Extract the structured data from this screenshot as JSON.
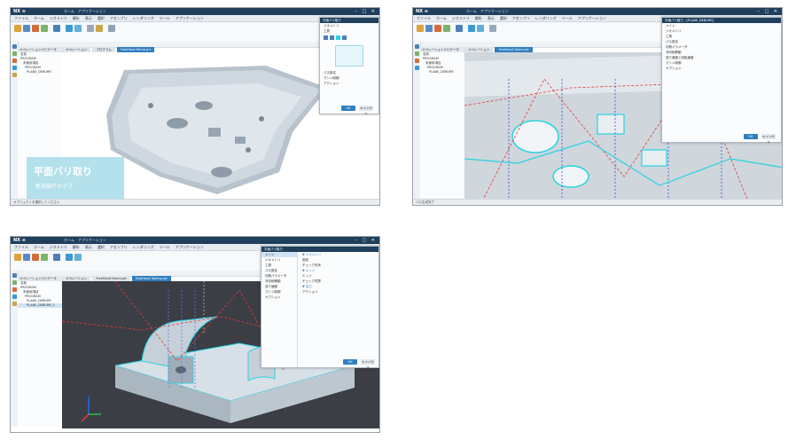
{
  "app": {
    "brand": "NX ≡",
    "window_title": "ホーム　アプリケーション",
    "window_buttons": "–  □  ✕",
    "menu": [
      "ファイル",
      "ホーム",
      "ジオメトリ",
      "解析",
      "表示",
      "選択",
      "アセンブリ",
      "レンダリング",
      "ツール",
      "アプリケーション",
      "環境設定",
      "ツールボックス"
    ],
    "colors": {
      "titlebar": "#1f3f5c",
      "accent": "#2f7fc1",
      "model": "#c9d3dc",
      "cyan_edge": "#27d3e3"
    }
  },
  "panel1": {
    "tabs": [
      "オペレーション",
      "プログラム",
      "FreeHand Demo.prt"
    ],
    "navigator_header": "オペレーションナビゲータ",
    "navigator_items": [
      "名前",
      "PROGRAM",
      "未使用項目",
      "PROGRAM",
      "PLANE_DEBURR"
    ],
    "dialog_title": "平面バリ取り",
    "dialog_rows": [
      "ジオメトリ",
      "工具",
      "パス設定",
      "マシン制御",
      "アクション"
    ],
    "dialog_ok": "OK",
    "dialog_cancel": "キャンセル",
    "caption_main": "平面バリ取り",
    "caption_sub": "新規操作タイプ",
    "status": "オブジェクトを選択してください"
  },
  "panel2": {
    "tabs": [
      "オペレーション",
      "FreeHand Demo.prt"
    ],
    "navigator_header": "オペレーションナビゲータ",
    "navigator_items": [
      "名前",
      "PROGRAM",
      "未使用項目",
      "PROGRAM",
      "PLANE_DEBURR"
    ],
    "dialog_title": "平面バリ取り - [PLANE_DEBURR]",
    "dialog_rows": [
      "メイン",
      "ジオメトリ",
      "工具",
      "パス設定",
      "切削パラメータ",
      "非切削移動",
      "送り速度と回転速度",
      "マシン制御",
      "オプション"
    ],
    "dialog_ok": "OK",
    "dialog_cancel": "キャンセル",
    "status": "パス生成完了"
  },
  "panel3": {
    "tabs": [
      "オペレーション",
      "FreeHand Demo.prt",
      "FreeHand Tooling.prt"
    ],
    "navigator_header": "オペレーションナビゲータ",
    "navigator_items": [
      "名前",
      "PROGRAM",
      "未使用項目",
      "PROGRAM",
      "PLANE_DEBURR",
      "PLANE_DEBURR_1"
    ],
    "dialog_title": "平面バリ取り",
    "dialog_rows": [
      "メイン",
      "ジオメトリ",
      "工具",
      "パス設定",
      "切削パラメータ",
      "非切削移動",
      "送り速度",
      "マシン制御",
      "オプション"
    ],
    "dialog_right_rows": [
      "▼ ジオメトリ",
      "部品",
      "チェック形状",
      "▼ エッジ",
      "エッジ",
      "チェック境界",
      "▼ 出力",
      "アクション"
    ],
    "dialog_ok": "OK",
    "dialog_cancel": "キャンセル"
  }
}
